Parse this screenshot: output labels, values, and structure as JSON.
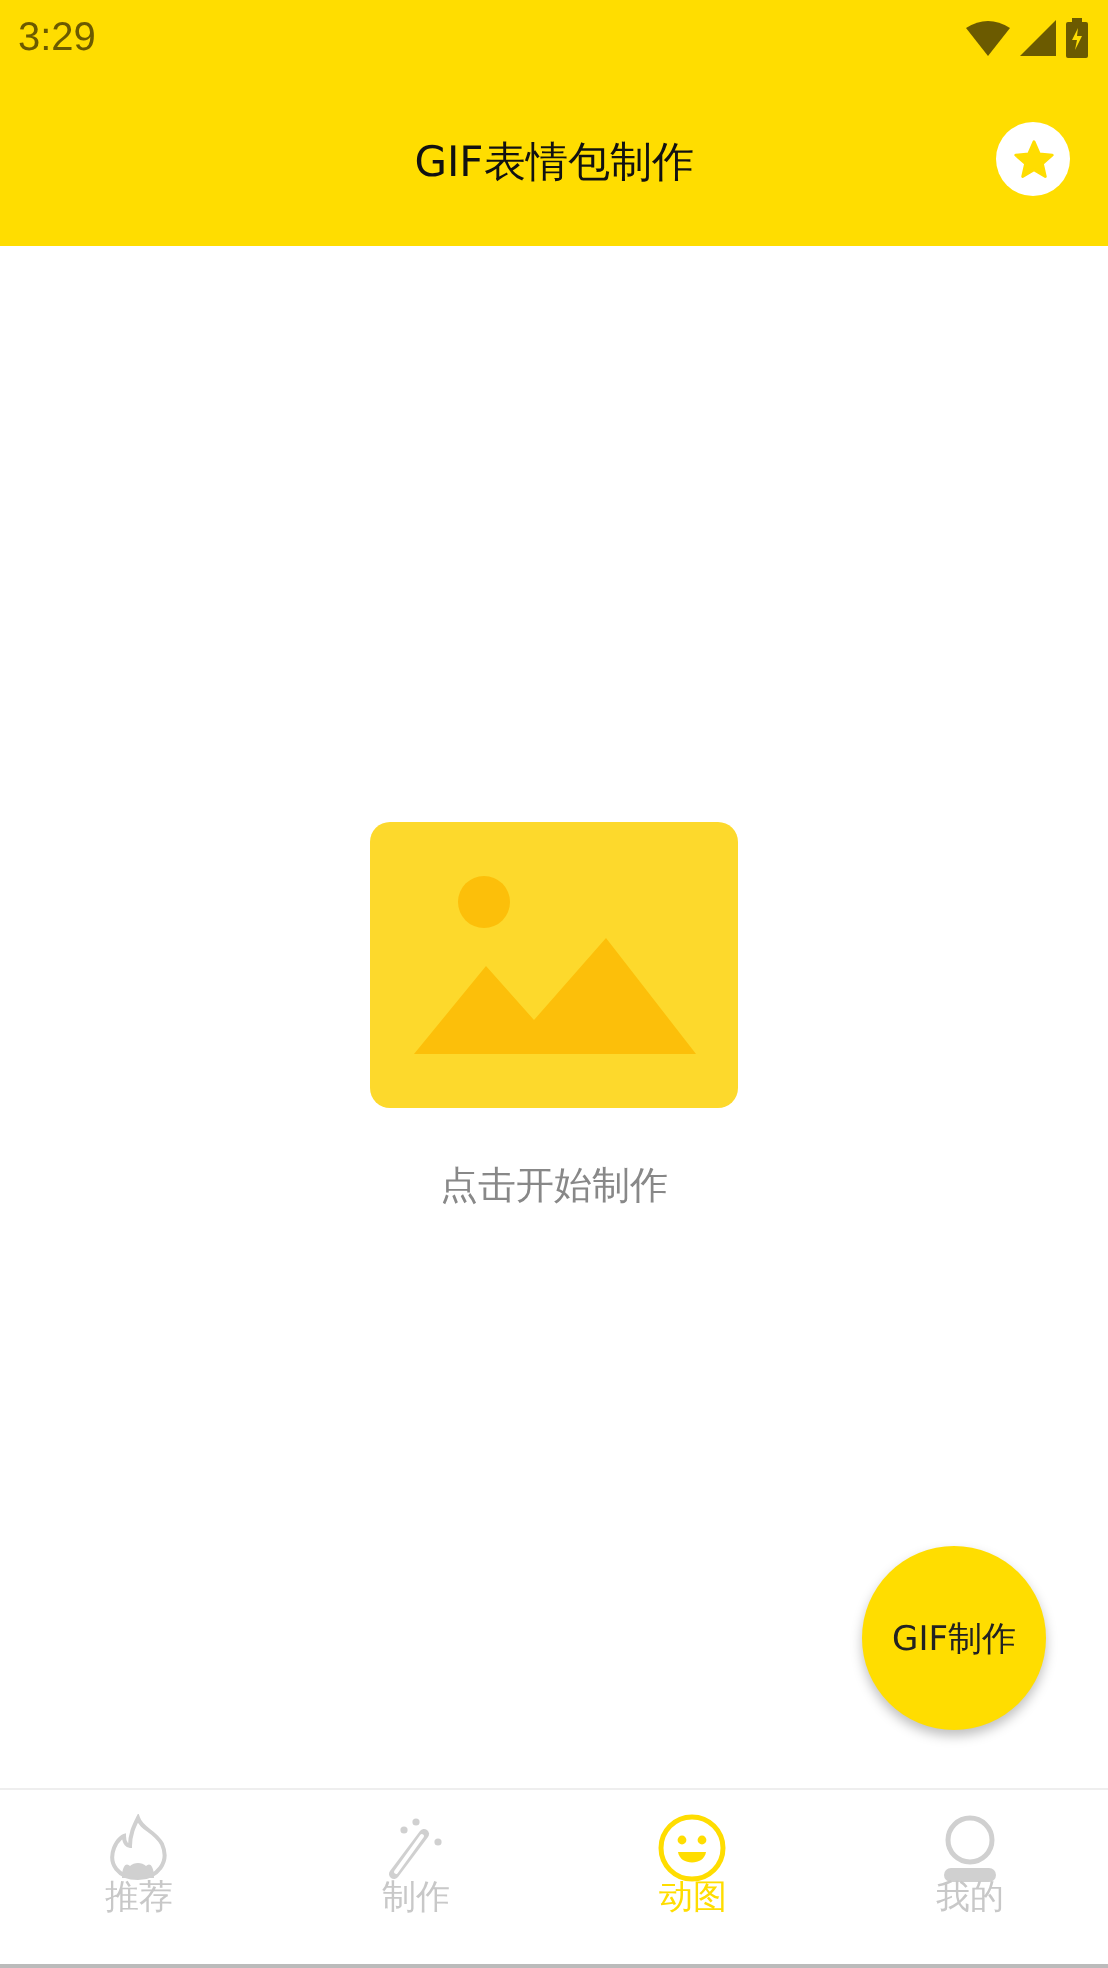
{
  "status_bar": {
    "time": "3:29"
  },
  "app_bar": {
    "title": "GIF表情包制作"
  },
  "empty_state": {
    "hint": "点击开始制作"
  },
  "fab": {
    "label": "GIF制作"
  },
  "tabs": [
    {
      "label": "推荐",
      "kind": "flame",
      "selected": false
    },
    {
      "label": "制作",
      "kind": "wand",
      "selected": false
    },
    {
      "label": "动图",
      "kind": "smile",
      "selected": true
    },
    {
      "label": "我的",
      "kind": "person",
      "selected": false
    }
  ]
}
